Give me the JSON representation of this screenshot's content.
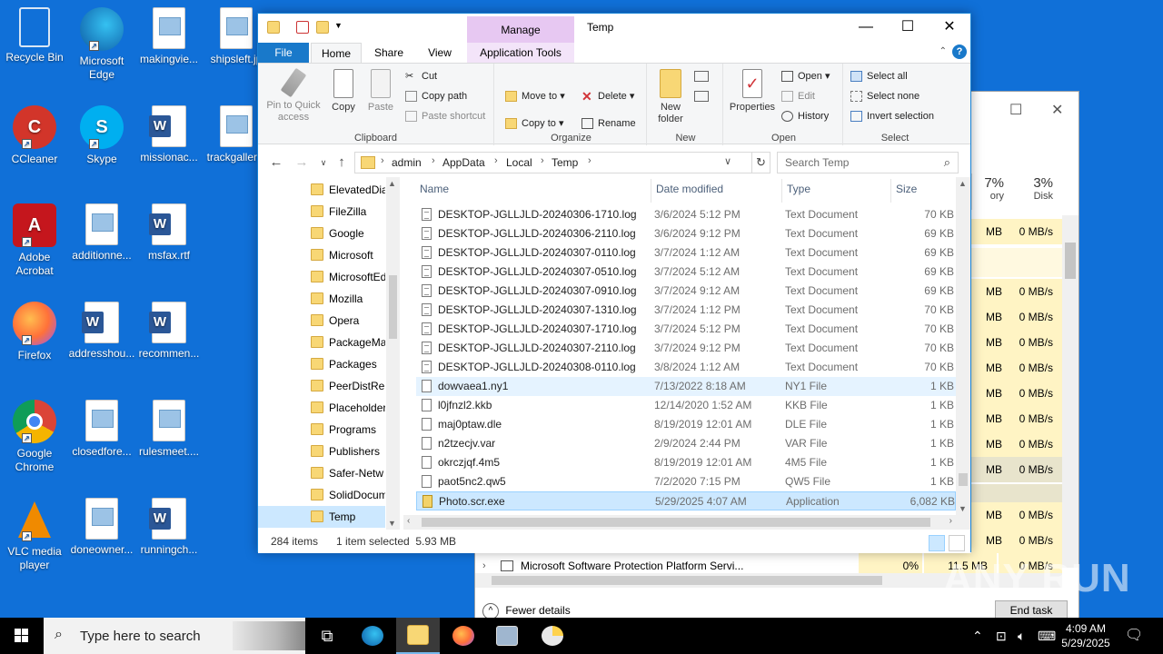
{
  "desktop": {
    "icons": [
      {
        "label": "Recycle Bin"
      },
      {
        "label": "Microsoft Edge"
      },
      {
        "label": "makingvie..."
      },
      {
        "label": "shipsleft.jp"
      },
      {
        "label": "CCleaner"
      },
      {
        "label": "Skype"
      },
      {
        "label": "missionac..."
      },
      {
        "label": "trackgaller..."
      },
      {
        "label": "Adobe Acrobat"
      },
      {
        "label": "additionne..."
      },
      {
        "label": "msfax.rtf"
      },
      {
        "label": "Firefox"
      },
      {
        "label": "addresshou..."
      },
      {
        "label": "recommen..."
      },
      {
        "label": "Google Chrome"
      },
      {
        "label": "closedfore..."
      },
      {
        "label": "rulesmeet...."
      },
      {
        "label": "VLC media player"
      },
      {
        "label": "doneowner..."
      },
      {
        "label": "runningch..."
      }
    ]
  },
  "taskmgr": {
    "col1_pct": "7%",
    "col1_label": "ory",
    "col2_pct": "3%",
    "col2_label": "Disk",
    "rows": [
      {
        "mem": "MB",
        "disk": "0 MB/s"
      },
      {
        "mem": "MB",
        "disk": "0 MB/s"
      },
      {
        "mem": "MB",
        "disk": "0 MB/s"
      },
      {
        "mem": "MB",
        "disk": "0 MB/s"
      },
      {
        "mem": "MB",
        "disk": "0 MB/s"
      },
      {
        "mem": "MB",
        "disk": "0 MB/s"
      },
      {
        "mem": "MB",
        "disk": "0 MB/s"
      },
      {
        "mem": "MB",
        "disk": "0 MB/s"
      },
      {
        "mem": "MB",
        "disk": "0 MB/s"
      },
      {
        "mem": "MB",
        "disk": "0 MB/s"
      },
      {
        "mem": "MB",
        "disk": "0 MB/s"
      }
    ],
    "bottom_process": "Microsoft Software Protection Platform Servi...",
    "bottom_cpu": "0%",
    "bottom_mem": "11.5 MB",
    "bottom_disk": "0 MB/s",
    "fewer_details": "Fewer details",
    "end_task": "End task"
  },
  "explorer": {
    "title": "Temp",
    "manage_tab": "Manage",
    "tabs": {
      "file": "File",
      "home": "Home",
      "share": "Share",
      "view": "View",
      "app_tools": "Application Tools"
    },
    "ribbon": {
      "pin": "Pin to Quick access",
      "copy": "Copy",
      "paste": "Paste",
      "cut": "Cut",
      "copy_path": "Copy path",
      "paste_shortcut": "Paste shortcut",
      "clipboard": "Clipboard",
      "move_to": "Move to",
      "copy_to": "Copy to",
      "delete": "Delete",
      "rename": "Rename",
      "organize": "Organize",
      "new_folder": "New folder",
      "new": "New",
      "properties": "Properties",
      "open": "Open",
      "edit": "Edit",
      "history": "History",
      "open_group": "Open",
      "select_all": "Select all",
      "select_none": "Select none",
      "invert_selection": "Invert selection",
      "select_group": "Select"
    },
    "address": {
      "crumbs": [
        "admin",
        "AppData",
        "Local",
        "Temp"
      ]
    },
    "search_placeholder": "Search Temp",
    "nav_items": [
      {
        "label": "ElevatedDia"
      },
      {
        "label": "FileZilla"
      },
      {
        "label": "Google"
      },
      {
        "label": "Microsoft"
      },
      {
        "label": "MicrosoftEd"
      },
      {
        "label": "Mozilla"
      },
      {
        "label": "Opera"
      },
      {
        "label": "PackageMa"
      },
      {
        "label": "Packages"
      },
      {
        "label": "PeerDistRep"
      },
      {
        "label": "Placeholder"
      },
      {
        "label": "Programs"
      },
      {
        "label": "Publishers"
      },
      {
        "label": "Safer-Netw"
      },
      {
        "label": "SolidDocum"
      },
      {
        "label": "Temp"
      }
    ],
    "columns": {
      "name": "Name",
      "date": "Date modified",
      "type": "Type",
      "size": "Size"
    },
    "files": [
      {
        "name": "DESKTOP-JGLLJLD-20240306-1710.log",
        "date": "3/6/2024 5:12 PM",
        "type": "Text Document",
        "size": "70 KB"
      },
      {
        "name": "DESKTOP-JGLLJLD-20240306-2110.log",
        "date": "3/6/2024 9:12 PM",
        "type": "Text Document",
        "size": "69 KB"
      },
      {
        "name": "DESKTOP-JGLLJLD-20240307-0110.log",
        "date": "3/7/2024 1:12 AM",
        "type": "Text Document",
        "size": "69 KB"
      },
      {
        "name": "DESKTOP-JGLLJLD-20240307-0510.log",
        "date": "3/7/2024 5:12 AM",
        "type": "Text Document",
        "size": "69 KB"
      },
      {
        "name": "DESKTOP-JGLLJLD-20240307-0910.log",
        "date": "3/7/2024 9:12 AM",
        "type": "Text Document",
        "size": "69 KB"
      },
      {
        "name": "DESKTOP-JGLLJLD-20240307-1310.log",
        "date": "3/7/2024 1:12 PM",
        "type": "Text Document",
        "size": "70 KB"
      },
      {
        "name": "DESKTOP-JGLLJLD-20240307-1710.log",
        "date": "3/7/2024 5:12 PM",
        "type": "Text Document",
        "size": "70 KB"
      },
      {
        "name": "DESKTOP-JGLLJLD-20240307-2110.log",
        "date": "3/7/2024 9:12 PM",
        "type": "Text Document",
        "size": "70 KB"
      },
      {
        "name": "DESKTOP-JGLLJLD-20240308-0110.log",
        "date": "3/8/2024 1:12 AM",
        "type": "Text Document",
        "size": "70 KB"
      },
      {
        "name": "dowvaea1.ny1",
        "date": "7/13/2022 8:18 AM",
        "type": "NY1 File",
        "size": "1 KB"
      },
      {
        "name": "l0jfnzl2.kkb",
        "date": "12/14/2020 1:52 AM",
        "type": "KKB File",
        "size": "1 KB"
      },
      {
        "name": "maj0ptaw.dle",
        "date": "8/19/2019 12:01 AM",
        "type": "DLE File",
        "size": "1 KB"
      },
      {
        "name": "n2tzecjv.var",
        "date": "2/9/2024 2:44 PM",
        "type": "VAR File",
        "size": "1 KB"
      },
      {
        "name": "okrczjqf.4m5",
        "date": "8/19/2019 12:01 AM",
        "type": "4M5 File",
        "size": "1 KB"
      },
      {
        "name": "paot5nc2.qw5",
        "date": "7/2/2020 7:15 PM",
        "type": "QW5 File",
        "size": "1 KB"
      },
      {
        "name": "Photo.scr.exe",
        "date": "5/29/2025 4:07 AM",
        "type": "Application",
        "size": "6,082 KB"
      }
    ],
    "status": {
      "count": "284 items",
      "selected": "1 item selected  5.93 MB"
    }
  },
  "taskbar": {
    "search_placeholder": "Type here to search",
    "time": "4:09 AM",
    "date": "5/29/2025"
  },
  "watermark": "ANY RUN"
}
